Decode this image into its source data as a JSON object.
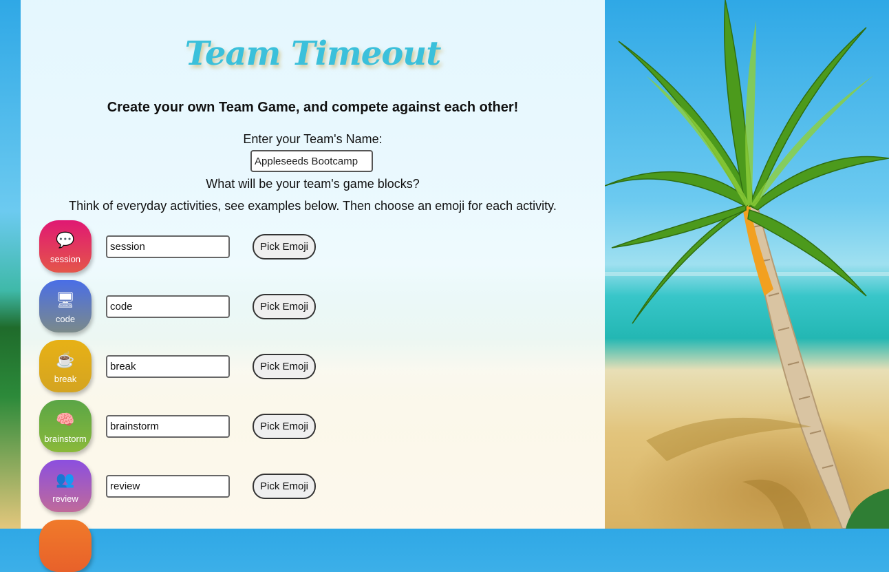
{
  "app": {
    "title": "Team Timeout",
    "subtitle": "Create your own Team Game, and compete against each other!"
  },
  "team": {
    "label": "Enter your Team's Name:",
    "value": "Appleseeds Bootcamp"
  },
  "blocks": {
    "question": "What will be your team's game blocks?",
    "hint": "Think of everyday activities, see examples below. Then choose an emoji for each activity.",
    "pick_label": "Pick Emoji",
    "items": [
      {
        "label": "session",
        "value": "session",
        "emoji": "💬",
        "icon": "speech-bubble-icon",
        "color_top": "#e01873",
        "color_bottom": "#e4564a"
      },
      {
        "label": "code",
        "value": "code",
        "emoji": "🖥",
        "icon": "computer-icon",
        "color_top": "#4a6ee6",
        "color_bottom": "#7b8a8a"
      },
      {
        "label": "break",
        "value": "break",
        "emoji": "☕",
        "icon": "coffee-icon",
        "color_top": "#e7b116",
        "color_bottom": "#d4a421"
      },
      {
        "label": "brainstorm",
        "value": "brainstorm",
        "emoji": "🧠",
        "icon": "brain-icon",
        "color_top": "#5aa546",
        "color_bottom": "#8ab93a"
      },
      {
        "label": "review",
        "value": "review",
        "emoji": "👥",
        "icon": "people-icon",
        "color_top": "#8b4fdf",
        "color_bottom": "#c06a9a"
      },
      {
        "label": "",
        "value": "",
        "emoji": "",
        "icon": "",
        "color_top": "#f07a2a",
        "color_bottom": "#e8612a"
      }
    ]
  }
}
